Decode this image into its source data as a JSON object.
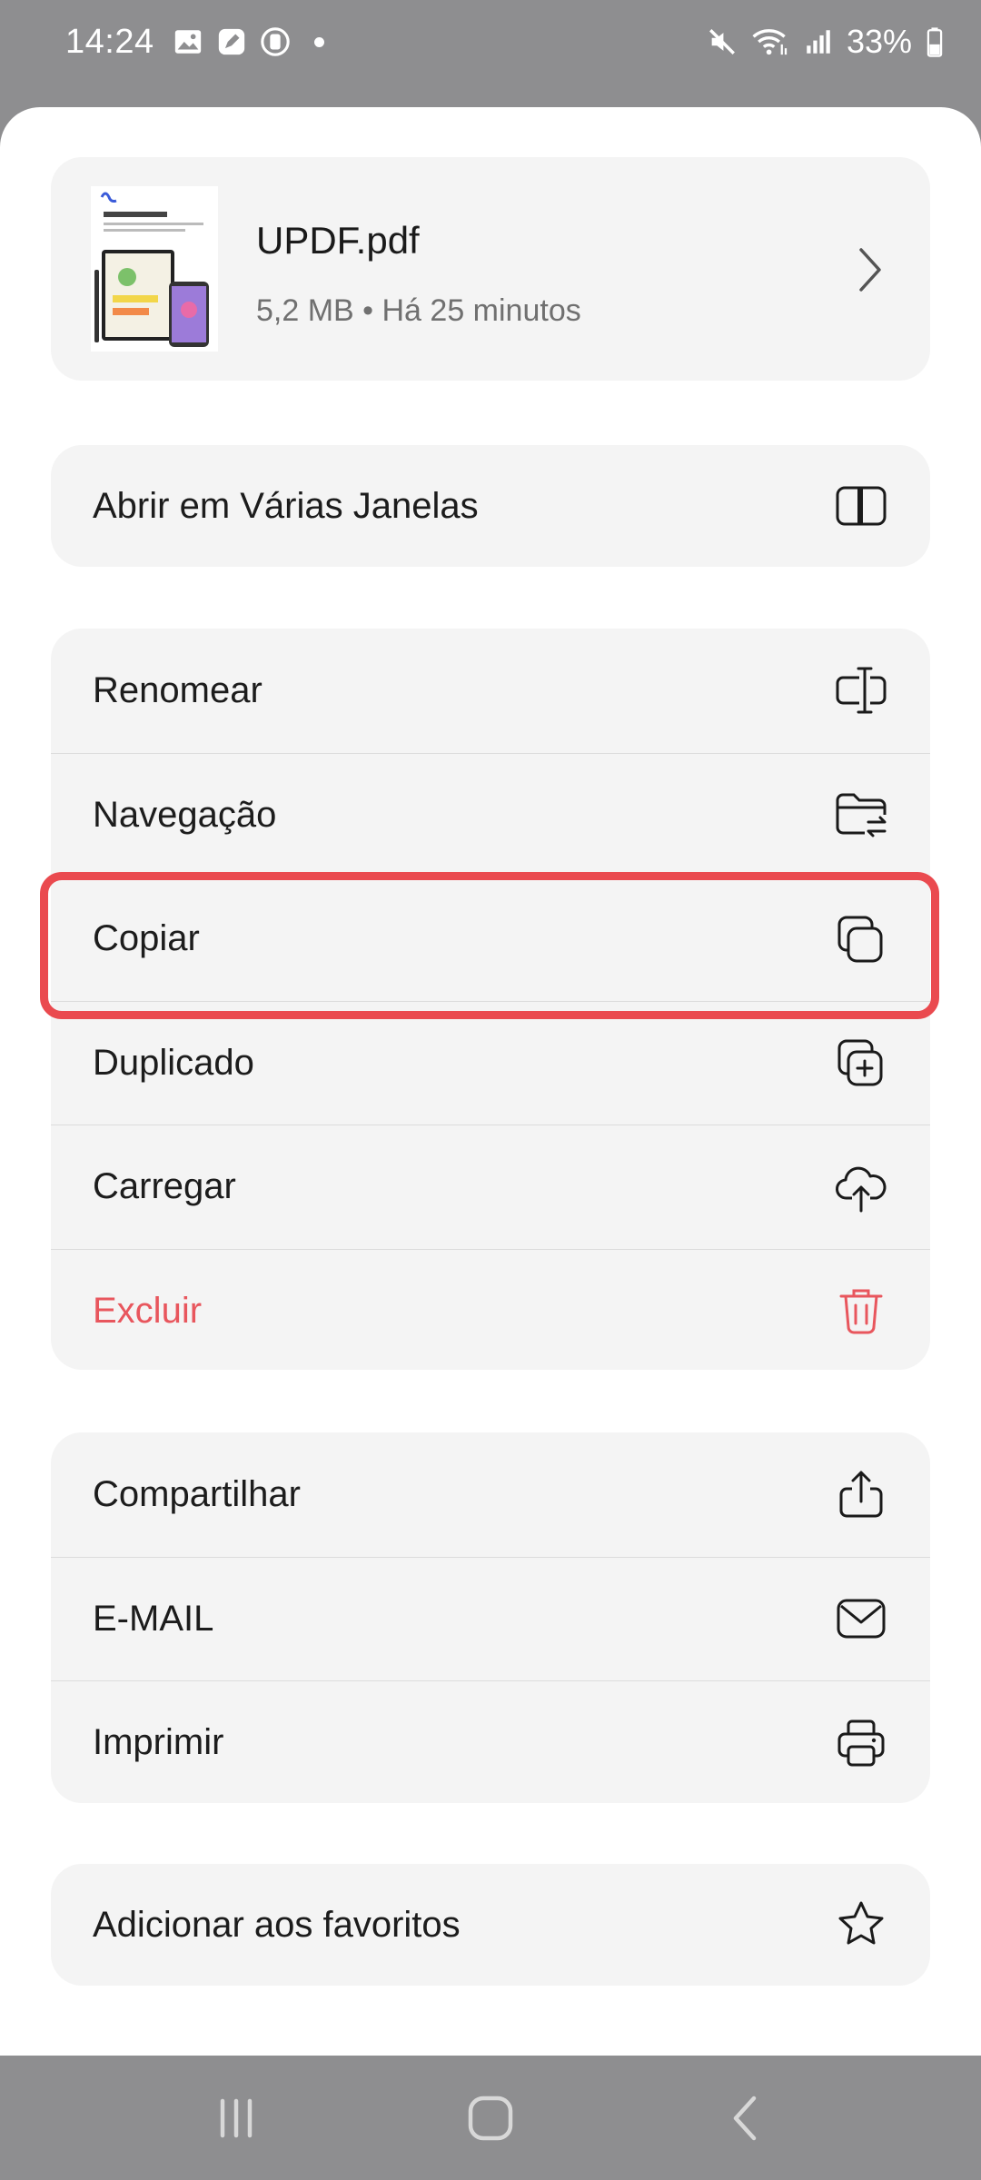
{
  "status_bar": {
    "time": "14:24",
    "battery": "33%"
  },
  "file": {
    "name": "UPDF.pdf",
    "meta": "5,2 MB • Há 25 minutos",
    "thumbnail_icon": "pdf-thumbnail"
  },
  "menu": {
    "multi_window": {
      "label": "Abrir em Várias Janelas",
      "icon": "split-window-icon"
    },
    "actions": [
      {
        "label": "Renomear",
        "icon": "rename-icon"
      },
      {
        "label": "Navegação",
        "icon": "folder-move-icon"
      },
      {
        "label": "Copiar",
        "icon": "copy-icon"
      },
      {
        "label": "Duplicado",
        "icon": "duplicate-icon"
      },
      {
        "label": "Carregar",
        "icon": "cloud-upload-icon"
      },
      {
        "label": "Excluir",
        "icon": "trash-icon"
      }
    ],
    "share": [
      {
        "label": "Compartilhar",
        "icon": "share-icon"
      },
      {
        "label": "E-MAIL",
        "icon": "email-icon"
      },
      {
        "label": "Imprimir",
        "icon": "print-icon"
      }
    ],
    "favorite": {
      "label": "Adicionar aos favoritos",
      "icon": "star-icon"
    }
  },
  "colors": {
    "danger": "#e8565d",
    "highlight": "#ea4a4f",
    "card": "#f4f4f4",
    "scrim": "#8e8e90"
  }
}
